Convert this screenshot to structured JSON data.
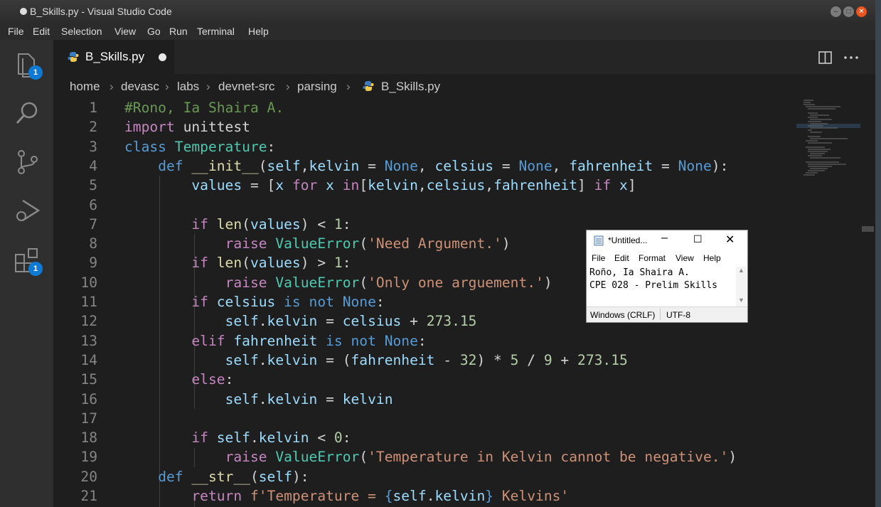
{
  "window": {
    "title": "B_Skills.py - Visual Studio Code"
  },
  "menu": [
    "File",
    "Edit",
    "Selection",
    "View",
    "Go",
    "Run",
    "Terminal",
    "Help"
  ],
  "activity": {
    "explorer_badge": "1",
    "extensions_badge": "1"
  },
  "tab": {
    "label": "B_Skills.py"
  },
  "breadcrumbs": [
    "home",
    "devasc",
    "labs",
    "devnet-src",
    "parsing",
    "B_Skills.py"
  ],
  "editor": {
    "lines": [
      [
        [
          "#Rono, Ia Shaira A.",
          "cmt"
        ]
      ],
      [
        [
          "import",
          "ctl"
        ],
        [
          " unittest",
          ""
        ]
      ],
      [
        [
          "class",
          "kw"
        ],
        [
          " ",
          ""
        ],
        [
          "Temperature",
          "cls"
        ],
        [
          ":",
          ""
        ]
      ],
      [
        [
          "    ",
          ""
        ],
        [
          "def",
          "kw"
        ],
        [
          " ",
          ""
        ],
        [
          "__init__",
          "fn"
        ],
        [
          "(",
          ""
        ],
        [
          "self",
          "var"
        ],
        [
          ",",
          ""
        ],
        [
          "kelvin",
          "var"
        ],
        [
          " = ",
          ""
        ],
        [
          "None",
          "kw"
        ],
        [
          ", ",
          ""
        ],
        [
          "celsius",
          "var"
        ],
        [
          " = ",
          ""
        ],
        [
          "None",
          "kw"
        ],
        [
          ", ",
          ""
        ],
        [
          "fahrenheit",
          "var"
        ],
        [
          " = ",
          ""
        ],
        [
          "None",
          "kw"
        ],
        [
          "):",
          ""
        ]
      ],
      [
        [
          "        ",
          ""
        ],
        [
          "values",
          "var"
        ],
        [
          " = [",
          ""
        ],
        [
          "x",
          "var"
        ],
        [
          " ",
          ""
        ],
        [
          "for",
          "ctl"
        ],
        [
          " ",
          ""
        ],
        [
          "x",
          "var"
        ],
        [
          " ",
          ""
        ],
        [
          "in",
          "ctl"
        ],
        [
          "[",
          ""
        ],
        [
          "kelvin",
          "var"
        ],
        [
          ",",
          ""
        ],
        [
          "celsius",
          "var"
        ],
        [
          ",",
          ""
        ],
        [
          "fahrenheit",
          "var"
        ],
        [
          "] ",
          ""
        ],
        [
          "if",
          "ctl"
        ],
        [
          " ",
          ""
        ],
        [
          "x",
          "var"
        ],
        [
          "]",
          ""
        ]
      ],
      [
        [
          "",
          ""
        ]
      ],
      [
        [
          "        ",
          ""
        ],
        [
          "if",
          "ctl"
        ],
        [
          " ",
          ""
        ],
        [
          "len",
          "fn"
        ],
        [
          "(",
          ""
        ],
        [
          "values",
          "var"
        ],
        [
          ") < ",
          ""
        ],
        [
          "1",
          "num"
        ],
        [
          ":",
          ""
        ]
      ],
      [
        [
          "            ",
          ""
        ],
        [
          "raise",
          "ctl"
        ],
        [
          " ",
          ""
        ],
        [
          "ValueError",
          "cls"
        ],
        [
          "(",
          ""
        ],
        [
          "'Need Argument.'",
          "str"
        ],
        [
          ")",
          ""
        ]
      ],
      [
        [
          "        ",
          ""
        ],
        [
          "if",
          "ctl"
        ],
        [
          " ",
          ""
        ],
        [
          "len",
          "fn"
        ],
        [
          "(",
          ""
        ],
        [
          "values",
          "var"
        ],
        [
          ") > ",
          ""
        ],
        [
          "1",
          "num"
        ],
        [
          ":",
          ""
        ]
      ],
      [
        [
          "            ",
          ""
        ],
        [
          "raise",
          "ctl"
        ],
        [
          " ",
          ""
        ],
        [
          "ValueError",
          "cls"
        ],
        [
          "(",
          ""
        ],
        [
          "'Only one arguement.'",
          "str"
        ],
        [
          ")",
          ""
        ]
      ],
      [
        [
          "        ",
          ""
        ],
        [
          "if",
          "ctl"
        ],
        [
          " ",
          ""
        ],
        [
          "celsius",
          "var"
        ],
        [
          " ",
          ""
        ],
        [
          "is",
          "kw"
        ],
        [
          " ",
          ""
        ],
        [
          "not",
          "kw"
        ],
        [
          " ",
          ""
        ],
        [
          "None",
          "kw"
        ],
        [
          ":",
          ""
        ]
      ],
      [
        [
          "            ",
          ""
        ],
        [
          "self",
          "var"
        ],
        [
          ".",
          ""
        ],
        [
          "kelvin",
          "var"
        ],
        [
          " = ",
          ""
        ],
        [
          "celsius",
          "var"
        ],
        [
          " + ",
          ""
        ],
        [
          "273.15",
          "num"
        ]
      ],
      [
        [
          "        ",
          ""
        ],
        [
          "elif",
          "ctl"
        ],
        [
          " ",
          ""
        ],
        [
          "fahrenheit",
          "var"
        ],
        [
          " ",
          ""
        ],
        [
          "is",
          "kw"
        ],
        [
          " ",
          ""
        ],
        [
          "not",
          "kw"
        ],
        [
          " ",
          ""
        ],
        [
          "None",
          "kw"
        ],
        [
          ":",
          ""
        ]
      ],
      [
        [
          "            ",
          ""
        ],
        [
          "self",
          "var"
        ],
        [
          ".",
          ""
        ],
        [
          "kelvin",
          "var"
        ],
        [
          " = (",
          ""
        ],
        [
          "fahrenheit",
          "var"
        ],
        [
          " - ",
          ""
        ],
        [
          "32",
          "num"
        ],
        [
          ") * ",
          ""
        ],
        [
          "5",
          "num"
        ],
        [
          " / ",
          ""
        ],
        [
          "9",
          "num"
        ],
        [
          " + ",
          ""
        ],
        [
          "273.15",
          "num"
        ]
      ],
      [
        [
          "        ",
          ""
        ],
        [
          "else",
          "ctl"
        ],
        [
          ":",
          ""
        ]
      ],
      [
        [
          "            ",
          ""
        ],
        [
          "self",
          "var"
        ],
        [
          ".",
          ""
        ],
        [
          "kelvin",
          "var"
        ],
        [
          " = ",
          ""
        ],
        [
          "kelvin",
          "var"
        ]
      ],
      [
        [
          "",
          ""
        ]
      ],
      [
        [
          "        ",
          ""
        ],
        [
          "if",
          "ctl"
        ],
        [
          " ",
          ""
        ],
        [
          "self",
          "var"
        ],
        [
          ".",
          ""
        ],
        [
          "kelvin",
          "var"
        ],
        [
          " < ",
          ""
        ],
        [
          "0",
          "num"
        ],
        [
          ":",
          ""
        ]
      ],
      [
        [
          "            ",
          ""
        ],
        [
          "raise",
          "ctl"
        ],
        [
          " ",
          ""
        ],
        [
          "ValueError",
          "cls"
        ],
        [
          "(",
          ""
        ],
        [
          "'Temperature in Kelvin cannot be negative.'",
          "str"
        ],
        [
          ")",
          ""
        ]
      ],
      [
        [
          "    ",
          ""
        ],
        [
          "def",
          "kw"
        ],
        [
          " ",
          ""
        ],
        [
          "__str__",
          "fn"
        ],
        [
          "(",
          ""
        ],
        [
          "self",
          "var"
        ],
        [
          "):",
          ""
        ]
      ],
      [
        [
          "        ",
          ""
        ],
        [
          "return",
          "ctl"
        ],
        [
          " ",
          ""
        ],
        [
          "f'Temperature = ",
          "str"
        ],
        [
          "{",
          "kw"
        ],
        [
          "self",
          "var"
        ],
        [
          ".",
          ""
        ],
        [
          "kelvin",
          "var"
        ],
        [
          "}",
          "kw"
        ],
        [
          " Kelvins'",
          "str"
        ]
      ]
    ]
  },
  "notepad": {
    "title": "*Untitled...",
    "menu": [
      "File",
      "Edit",
      "Format",
      "View",
      "Help"
    ],
    "text": "Roño, Ia Shaira A.\nCPE 028 - Prelim Skills",
    "line_ending": "Windows (CRLF)",
    "encoding": "UTF-8"
  }
}
